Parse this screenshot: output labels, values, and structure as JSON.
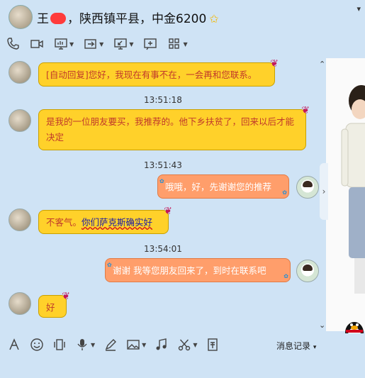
{
  "header": {
    "title_prefix": "王",
    "title_rest": "，陕西镇平县，中金6200",
    "star": "✩",
    "dropdown": "▾"
  },
  "toolbar": {
    "icons": [
      "phone-icon",
      "video-icon",
      "screen-share-icon",
      "transfer-file-icon",
      "remote-desktop-icon",
      "whiteboard-icon",
      "apps-icon"
    ]
  },
  "messages": [
    {
      "side": "left",
      "text": "[自动回复]您好，我现在有事不在，一会再和您联系。"
    },
    {
      "time": "13:51:18"
    },
    {
      "side": "left",
      "text": "是我的一位朋友要买，我推荐的。他下乡扶贫了，回来以后才能决定"
    },
    {
      "time": "13:51:43"
    },
    {
      "side": "right",
      "text": "哦哦，好，先谢谢您的推荐"
    },
    {
      "side": "left",
      "text_plain": "不客气。",
      "text_underline": "你们萨克斯确实好"
    },
    {
      "time": "13:54:01"
    },
    {
      "side": "right",
      "text": "谢谢  我等您朋友回来了，到时在联系吧"
    },
    {
      "side": "left",
      "text": "好"
    }
  ],
  "bottom": {
    "history_label": "消息记录",
    "history_caret": "▾"
  },
  "right_panel": {
    "collapse_arrow": "›",
    "scroll_up": "⌃",
    "scroll_down": "⌄"
  }
}
